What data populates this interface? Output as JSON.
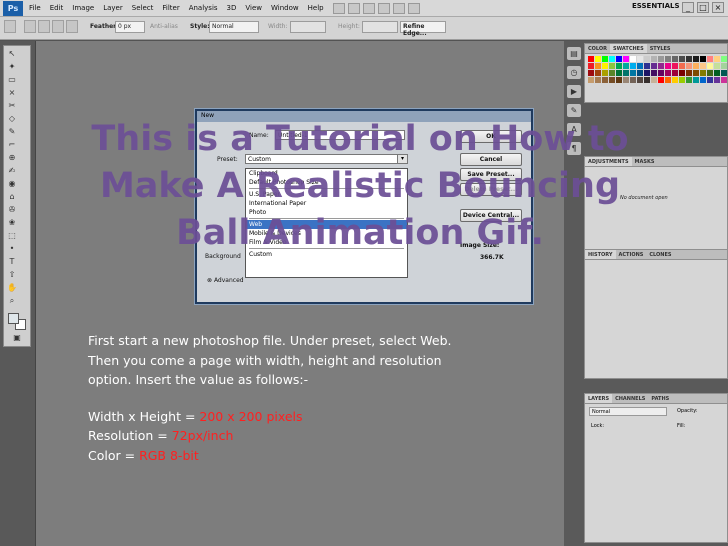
{
  "menubar": {
    "logo": "Ps",
    "items": [
      "File",
      "Edit",
      "Image",
      "Layer",
      "Select",
      "Filter",
      "Analysis",
      "3D",
      "View",
      "Window",
      "Help"
    ],
    "workspace": "ESSENTIALS ▾",
    "win_min": "_",
    "win_max": "□",
    "win_close": "×"
  },
  "options_bar": {
    "feather_label": "Feather:",
    "feather_value": "0 px",
    "antialias_label": "Anti-alias",
    "style_label": "Style:",
    "style_value": "Normal",
    "width_label": "Width:",
    "height_label": "Height:",
    "refine_edge": "Refine Edge..."
  },
  "tools": {
    "icons": [
      "↖",
      "✦",
      "▭",
      "⨯",
      "✂",
      "◇",
      "✎",
      "⌐",
      "⊕",
      "✍",
      "◉",
      "⌂",
      "✇",
      "❀",
      "⬚",
      "•",
      "T",
      "⇧",
      "✋",
      "⌕"
    ],
    "quickmask_icon": "▣"
  },
  "right_panels": {
    "swatch_tabs": [
      "COLOR",
      "SWATCHES",
      "STYLES"
    ],
    "swatch_colors": [
      "#ff0000",
      "#ffff00",
      "#00ff00",
      "#00ffff",
      "#0000ff",
      "#ff00ff",
      "#ffffff",
      "#e6e6e6",
      "#cccccc",
      "#b3b3b3",
      "#999999",
      "#808080",
      "#666666",
      "#4d4d4d",
      "#333333",
      "#1a1a1a",
      "#000000",
      "#ff8080",
      "#ffd080",
      "#80ff80",
      "#ed1c24",
      "#f7941d",
      "#fff200",
      "#8dc63f",
      "#00a651",
      "#00a99d",
      "#00aeef",
      "#0072bc",
      "#2e3192",
      "#662d91",
      "#92278f",
      "#ec008c",
      "#ed145b",
      "#f26c4f",
      "#f69679",
      "#fbaf5d",
      "#fdc689",
      "#fff799",
      "#c4df9b",
      "#a3d39c",
      "#9e0b0f",
      "#a0410d",
      "#aba000",
      "#598527",
      "#007236",
      "#00746b",
      "#0076a3",
      "#004a80",
      "#1b1464",
      "#440e62",
      "#630460",
      "#9e005d",
      "#9e0039",
      "#790000",
      "#7b2e00",
      "#7d4900",
      "#827b00",
      "#406618",
      "#005e20",
      "#005952",
      "#c69c6d",
      "#a67c52",
      "#8c6239",
      "#754c24",
      "#603913",
      "#998675",
      "#736357",
      "#534741",
      "#362f2d",
      "#c7b299",
      "#ff0000",
      "#ff6600",
      "#ffcc00",
      "#99cc00",
      "#339933",
      "#009999",
      "#0066cc",
      "#333399",
      "#663399",
      "#cc3399"
    ],
    "adjustments_tabs": [
      "ADJUSTMENTS",
      "MASKS"
    ],
    "no_document": "No document open",
    "history_tabs": [
      "HISTORY",
      "ACTIONS",
      "CLONES"
    ],
    "layers_tabs": [
      "LAYERS",
      "CHANNELS",
      "PATHS"
    ],
    "layers_blend": "Normal",
    "layers_opacity": "Opacity:",
    "layers_lock": "Lock:",
    "layers_fill": "Fill:"
  },
  "dialog": {
    "title": "New",
    "name_label": "Name:",
    "name_value": "Untitled-1",
    "preset_label": "Preset:",
    "preset_value": "Custom",
    "presets": [
      {
        "label": "Clipboard",
        "selected": false
      },
      {
        "label": "Default Photoshop Size",
        "selected": false
      },
      {
        "label": "sep",
        "selected": false
      },
      {
        "label": "U.S. Paper",
        "selected": false
      },
      {
        "label": "International Paper",
        "selected": false
      },
      {
        "label": "Photo",
        "selected": false
      },
      {
        "label": "sep",
        "selected": false
      },
      {
        "label": "Web",
        "selected": true
      },
      {
        "label": "Mobile & Devices",
        "selected": false
      },
      {
        "label": "Film & Video",
        "selected": false
      },
      {
        "label": "sep",
        "selected": false
      },
      {
        "label": "Custom",
        "selected": false
      }
    ],
    "background_label": "Background",
    "advanced_label": "Advanced",
    "ok": "OK",
    "cancel": "Cancel",
    "save_preset": "Save Preset...",
    "delete_preset": "Delete Preset...",
    "device_central": "Device Central...",
    "image_size_label": "Image Size:",
    "image_size_value": "366.7K"
  },
  "tutorial": {
    "title": "This is a Tutorial on How to Make A Realistic Bouncing Ball Animation Gif.",
    "intro": "First start a new photoshop file. Under preset, select Web. Then you come a page with width, height and resolution option. Insert the value as follows:-",
    "width_height_label": "Width x Height = ",
    "width_height_value": "200 x 200 pixels",
    "resolution_label": "Resolution = ",
    "resolution_value": "72px/inch",
    "color_label": "Color = ",
    "color_value": "RGB  8-bit"
  }
}
